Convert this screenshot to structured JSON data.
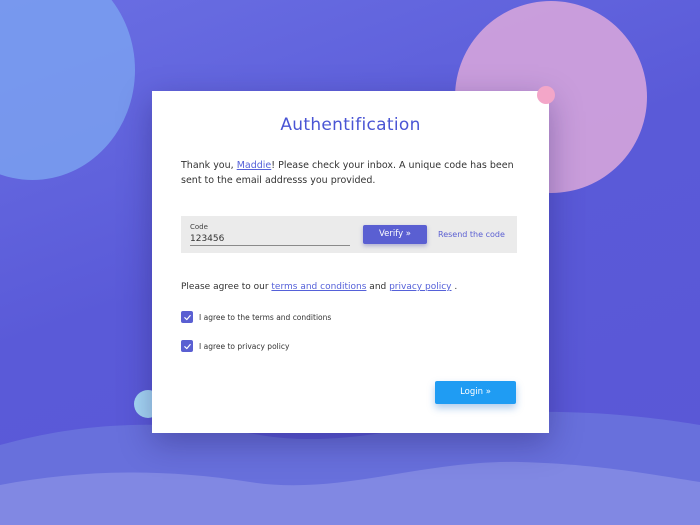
{
  "colors": {
    "accent": "#5a5fd2",
    "login_button": "#1f9cf3",
    "background": "#5a5ad8"
  },
  "card": {
    "title": "Authentification",
    "intro": {
      "before": "Thank you, ",
      "user_name": "Maddie",
      "after": "! Please check your inbox. A unique code has been sent to the email addresss you provided."
    }
  },
  "code_form": {
    "label": "Code",
    "value": "123456",
    "verify_label": "Verify »",
    "resend_label": "Resend the code"
  },
  "agreement": {
    "prefix": "Please agree to our ",
    "terms_link": "terms and conditions",
    "middle": " and ",
    "privacy_link": "privacy policy",
    "suffix": " .",
    "checkboxes": [
      {
        "label": "I agree to the terms and conditions",
        "checked": true
      },
      {
        "label": "I agree to privacy policy",
        "checked": true
      }
    ]
  },
  "login_label": "Login »",
  "icons": {
    "checkbox": "check-icon"
  }
}
